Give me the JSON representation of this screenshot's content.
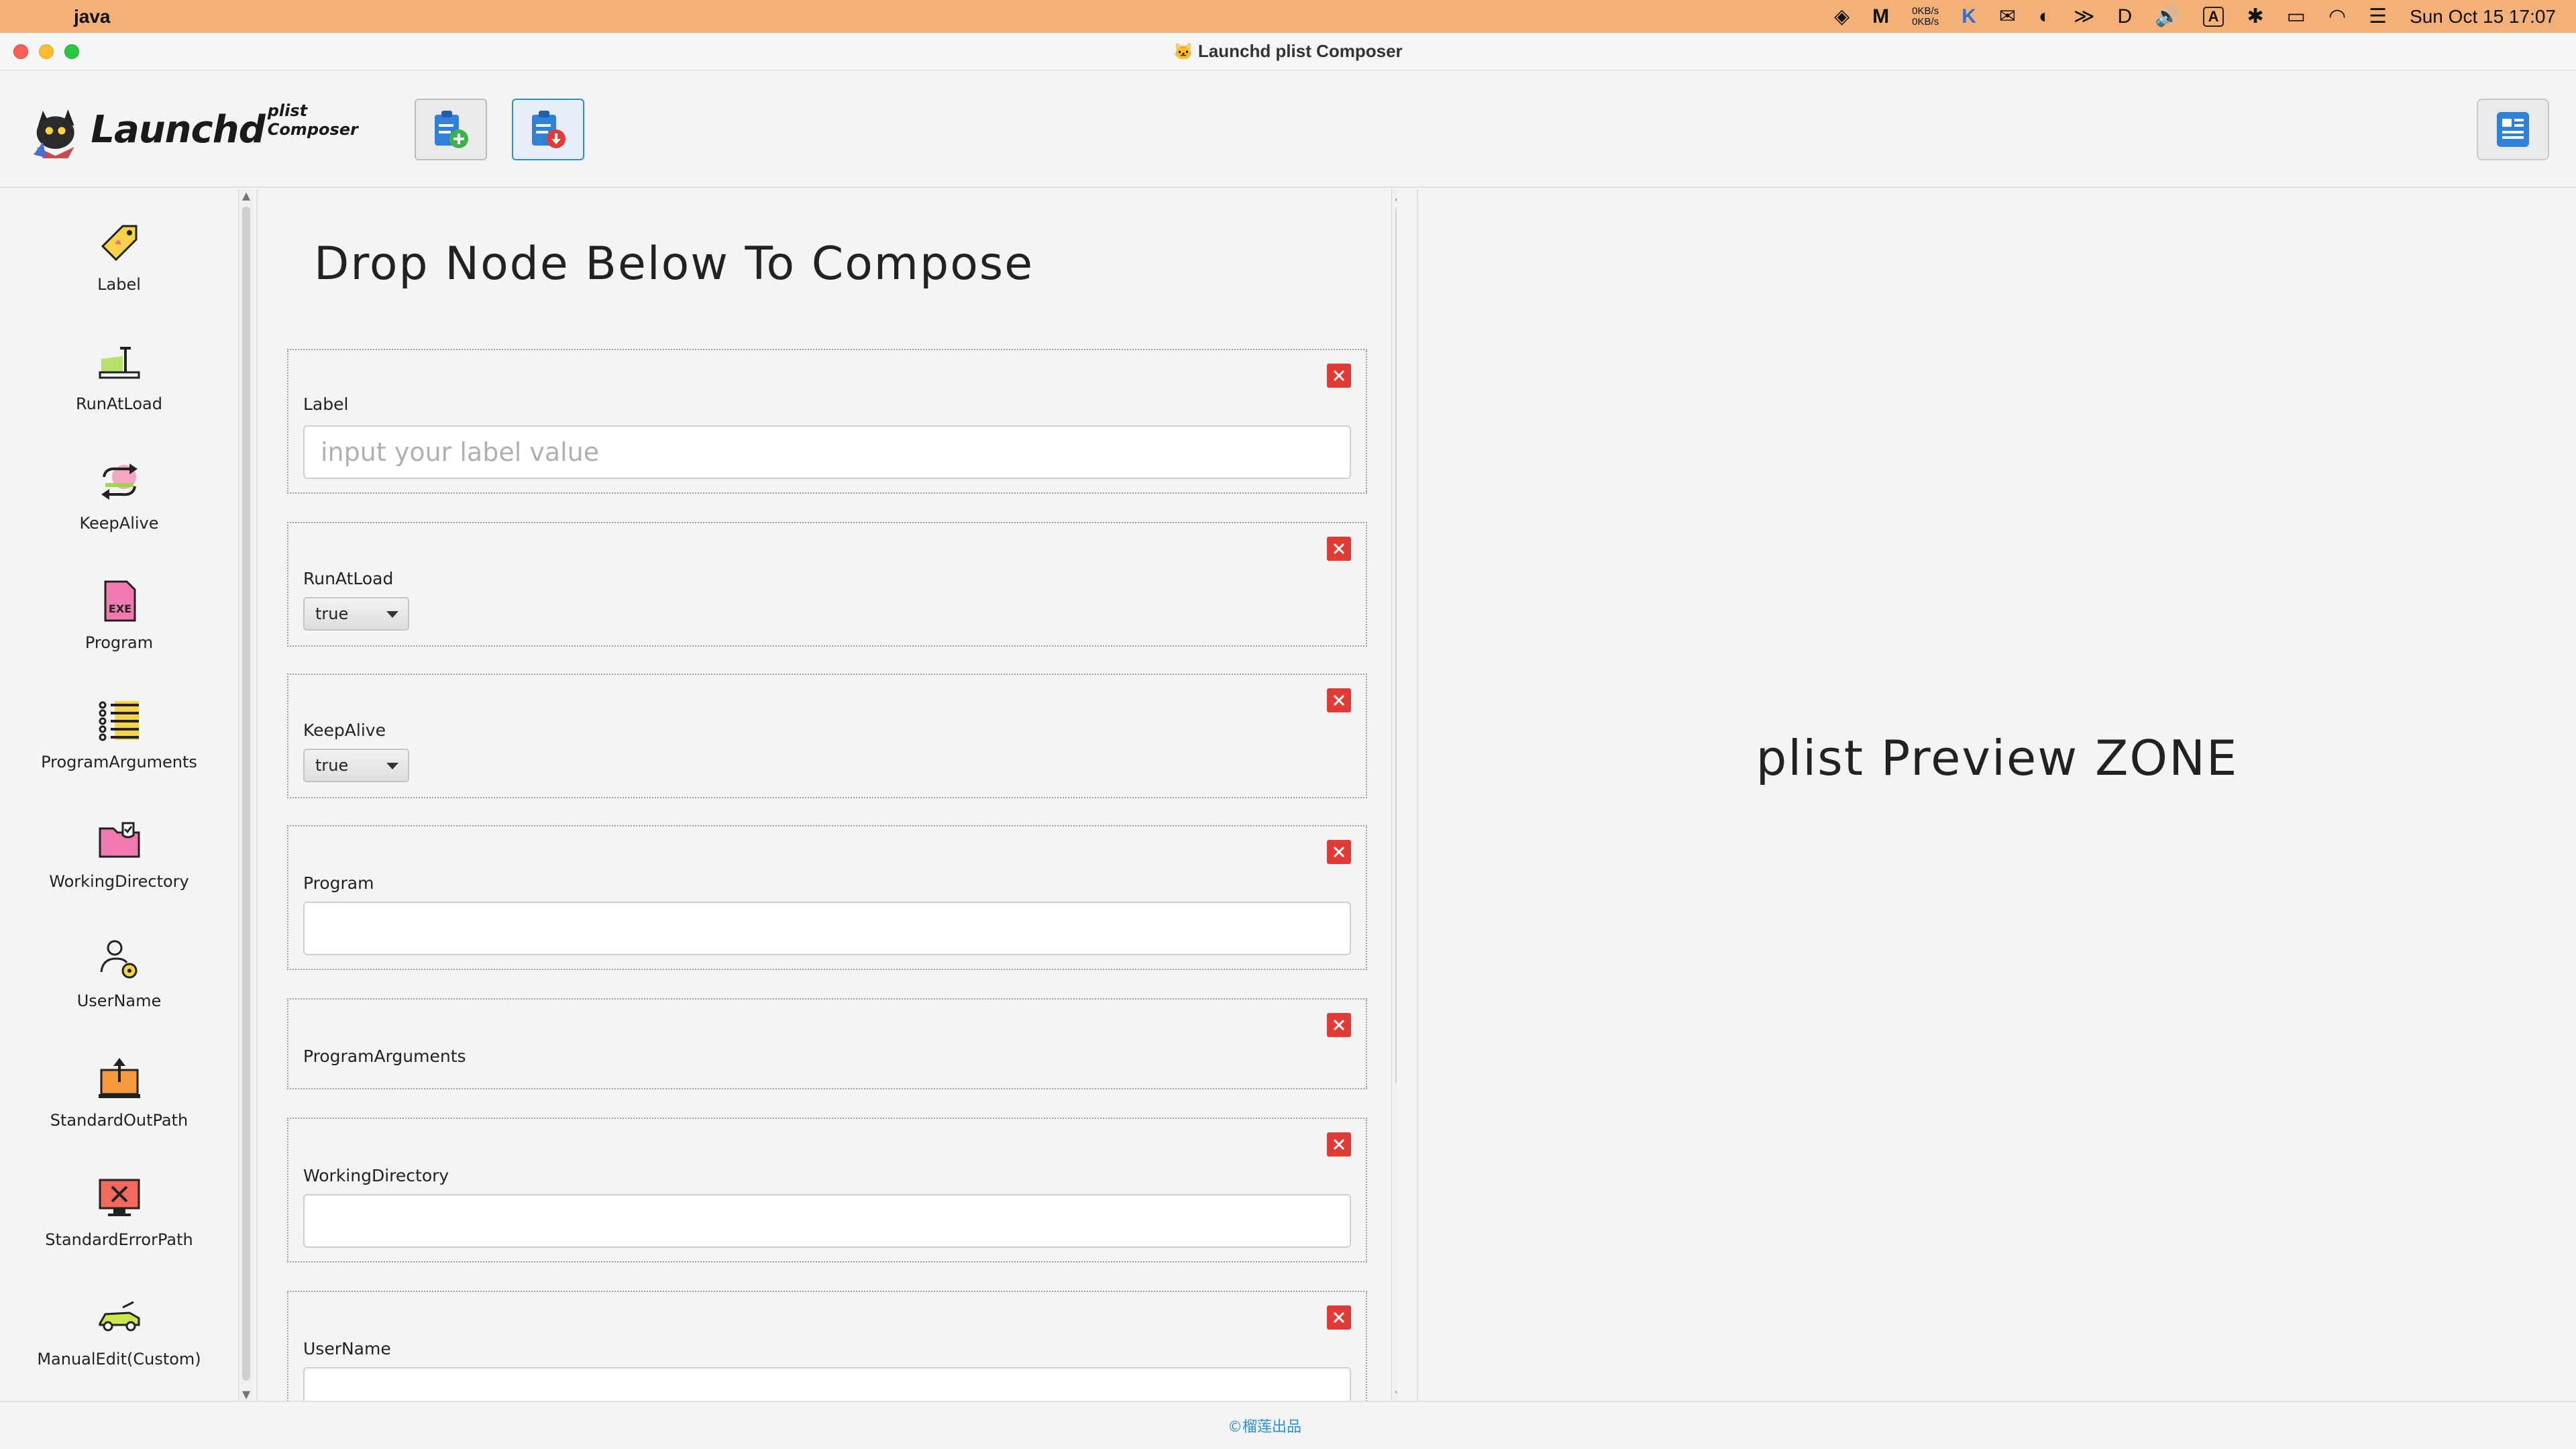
{
  "menubar": {
    "app_name": "java",
    "net_up": "0KB/s",
    "net_down": "0KB/s",
    "input_badge": "A",
    "datetime": "Sun Oct 15  17:07"
  },
  "window": {
    "title": "Launchd plist Composer"
  },
  "logo": {
    "main": "Launchd",
    "sub": "plist Composer"
  },
  "sidebar": {
    "items": [
      {
        "label": "Label",
        "icon": "tag-icon"
      },
      {
        "label": "RunAtLoad",
        "icon": "treadmill-icon"
      },
      {
        "label": "KeepAlive",
        "icon": "loop-arrows-icon"
      },
      {
        "label": "Program",
        "icon": "exe-file-icon"
      },
      {
        "label": "ProgramArguments",
        "icon": "list-icon"
      },
      {
        "label": "WorkingDirectory",
        "icon": "folder-check-icon"
      },
      {
        "label": "UserName",
        "icon": "user-gear-icon"
      },
      {
        "label": "StandardOutPath",
        "icon": "output-box-icon"
      },
      {
        "label": "StandardErrorPath",
        "icon": "error-monitor-icon"
      },
      {
        "label": "ManualEdit(Custom)",
        "icon": "custom-car-icon"
      }
    ]
  },
  "compose": {
    "title": "Drop Node Below To Compose",
    "nodes": [
      {
        "label": "Label",
        "placeholder": "input your label value",
        "value": ""
      },
      {
        "label": "RunAtLoad",
        "value": "true"
      },
      {
        "label": "KeepAlive",
        "value": "true"
      },
      {
        "label": "Program",
        "value": ""
      },
      {
        "label": "ProgramArguments"
      },
      {
        "label": "WorkingDirectory",
        "value": ""
      },
      {
        "label": "UserName",
        "value": ""
      }
    ]
  },
  "preview": {
    "text": "plist Preview ZONE"
  },
  "footer": {
    "text": "©榴莲出品"
  },
  "colors": {
    "accent": "#2a8fe0",
    "delete": "#e03b35",
    "menubar": "#f3b077"
  }
}
